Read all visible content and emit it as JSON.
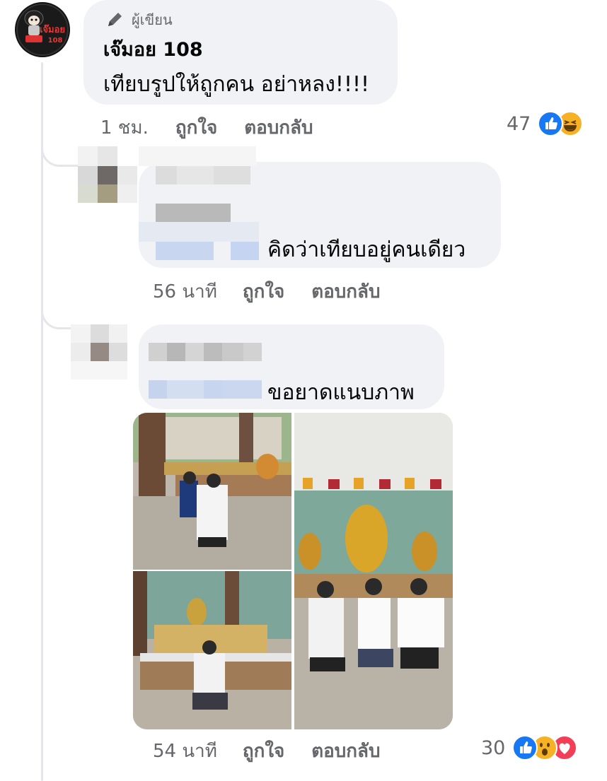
{
  "author_comment": {
    "badge_label": "ผู้เขียน",
    "author_name": "เจ๊มอย 108",
    "avatar_text": "เจ๊มอย",
    "avatar_number": "108",
    "text": "เทียบรูปให้ถูกคน อย่าหลง!!!!",
    "time": "1 ชม.",
    "like_label": "ถูกใจ",
    "reply_label": "ตอบกลับ",
    "reaction_count": "47",
    "reactions": [
      "like-icon",
      "haha-icon"
    ]
  },
  "reply_1": {
    "text": "คิดว่าเทียบอยู่คนเดียว",
    "time": "56 นาที",
    "like_label": "ถูกใจ",
    "reply_label": "ตอบกลับ"
  },
  "reply_2": {
    "text": "ขอยาดแนบภาพ",
    "time": "54 นาที",
    "like_label": "ถูกใจ",
    "reply_label": "ตอบกลับ",
    "reaction_count": "30",
    "reactions": [
      "like-icon",
      "wow-icon",
      "love-icon"
    ]
  },
  "colors": {
    "bubble_bg": "#f0f2f5",
    "secondary_text": "#65676b",
    "like_blue": "#1877f2",
    "love_red": "#f33e58",
    "haha_yellow": "#f7b125"
  }
}
